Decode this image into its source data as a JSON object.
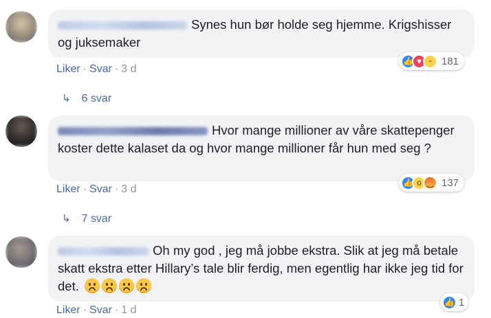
{
  "comments": [
    {
      "text": "Synes hun bør holde seg hjemme. Krigshisser og juksemaker",
      "actions": {
        "like": "Liker",
        "reply": "Svar",
        "age": "3 d"
      },
      "reaction_count": "181",
      "reaction_icons": [
        "like-icon",
        "love-icon",
        "haha-icon"
      ],
      "replies_label": "6 svar"
    },
    {
      "text": "Hvor mange millioner av våre skattepenger koster dette kalaset da og hvor mange millioner får hun med seg ?",
      "actions": {
        "like": "Liker",
        "reply": "Svar",
        "age": "3 d"
      },
      "reaction_count": "137",
      "reaction_icons": [
        "like-icon",
        "wow-icon",
        "angry-icon"
      ],
      "replies_label": "7 svar"
    },
    {
      "text": "Oh my god , jeg må jobbe ekstra. Slik at jeg må betale skatt ekstra etter Hillary’s tale blir ferdig, men egentlig har ikke jeg tid for det.",
      "actions": {
        "like": "Liker",
        "reply": "Svar",
        "age": "1 d"
      },
      "reaction_count": "1",
      "reaction_icons": [
        "like-icon"
      ],
      "emojis": [
        "frowning-face-icon",
        "frowning-face-icon",
        "frowning-face-icon",
        "frowning-face-icon"
      ]
    }
  ],
  "separator": "·",
  "colors": {
    "link": "#4b67a1",
    "bubble": "#f2f3f5",
    "like": "#2d88ff"
  }
}
